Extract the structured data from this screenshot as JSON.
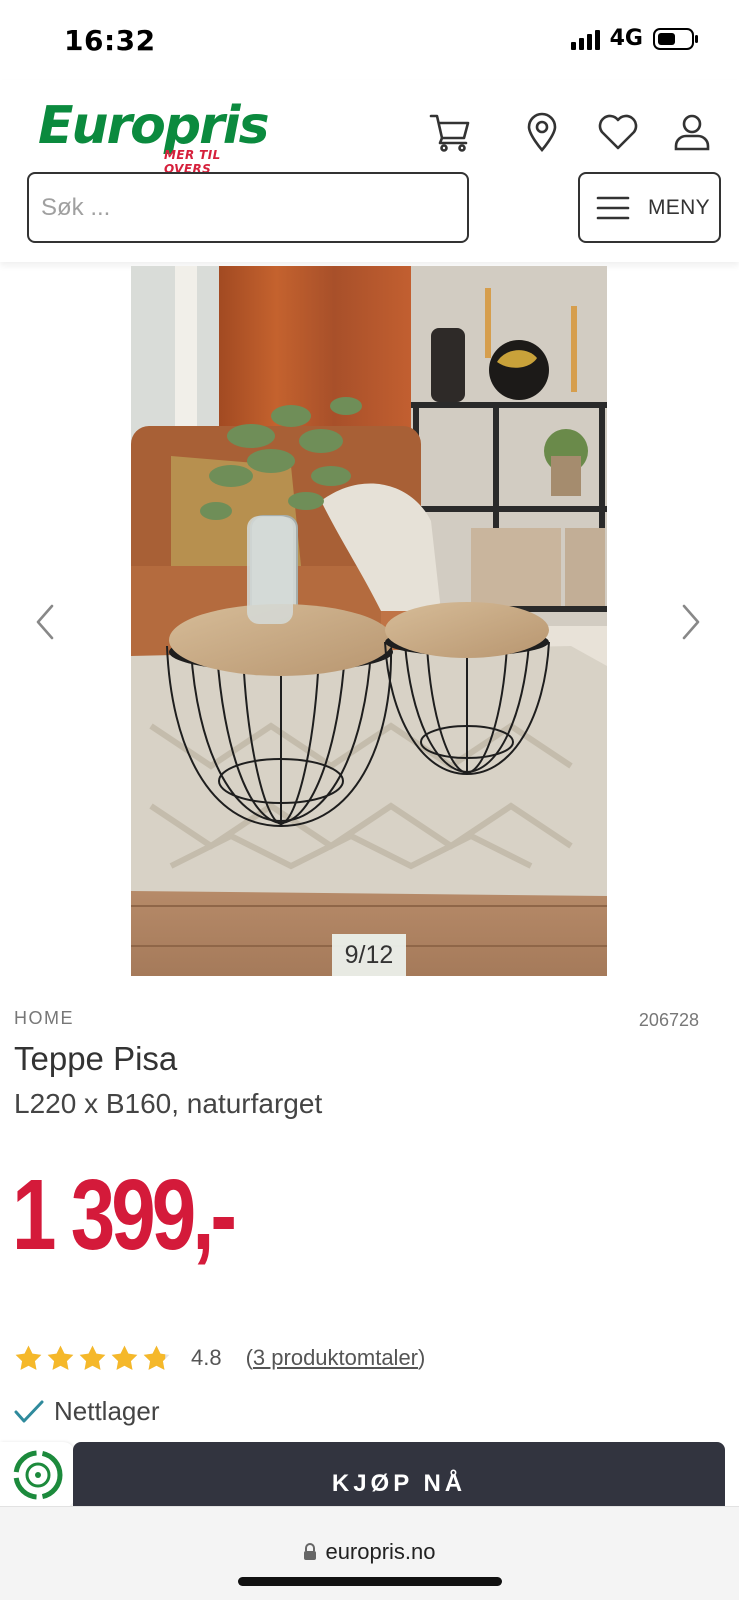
{
  "status_bar": {
    "time": "16:32",
    "network": "4G",
    "icons": [
      "signal-icon",
      "battery-icon"
    ]
  },
  "header": {
    "logo_text": "Europris",
    "logo_tagline": "MER TIL OVERS",
    "icons": [
      "cart-icon",
      "location-pin-icon",
      "heart-icon",
      "user-icon"
    ],
    "search_placeholder": "Søk ...",
    "menu_label": "MENY",
    "brand_colors": {
      "green": "#0b8a3e",
      "red": "#d6203c"
    }
  },
  "gallery": {
    "counter": "9/12",
    "prev_icon": "chevron-left-icon",
    "next_icon": "chevron-right-icon"
  },
  "product": {
    "brand": "HOME",
    "sku": "206728",
    "title": "Teppe Pisa",
    "subtitle": "L220 x B160, naturfarget",
    "price": "1 399,-",
    "price_color": "#d41a3a",
    "rating": 4.8,
    "rating_text": "4.8",
    "rating_max": 5,
    "reviews_open": "(",
    "reviews_link": "3 produktomtaler",
    "reviews_close": ")",
    "stock_label": "Nettlager"
  },
  "buy_bar": {
    "buy_label": "KJØP NÅ",
    "button_color": "#32343f"
  },
  "browser": {
    "url": "europris.no"
  }
}
